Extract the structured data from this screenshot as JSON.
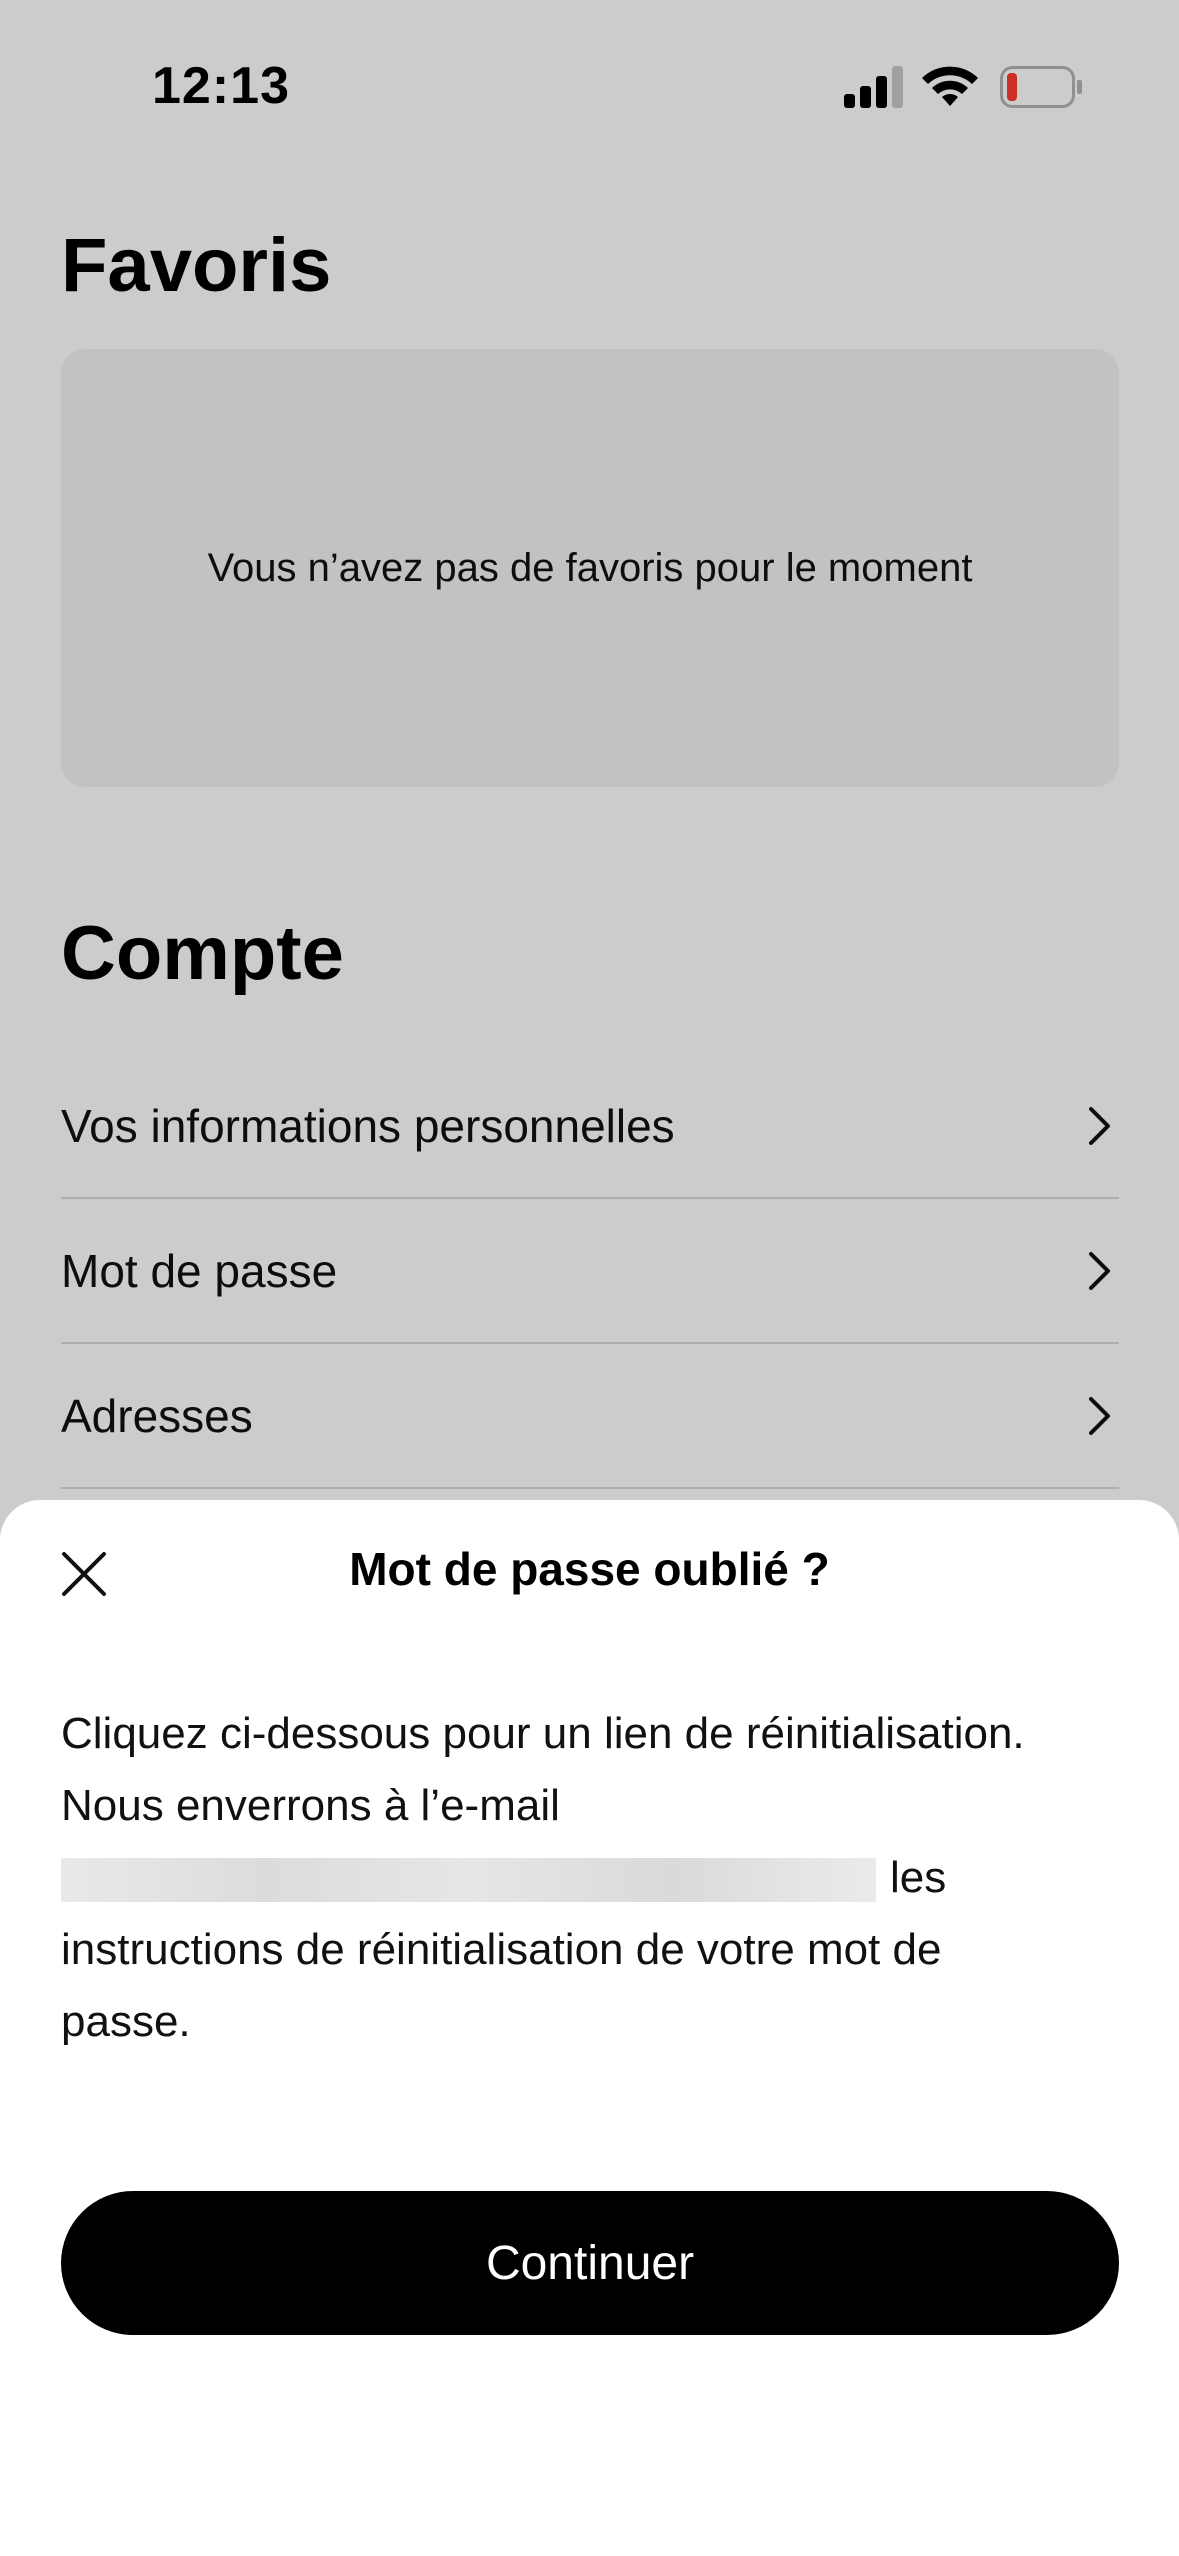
{
  "status_bar": {
    "time": "12:13",
    "signal_icon": "cellular-signal-icon",
    "wifi_icon": "wifi-icon",
    "battery_icon": "battery-low-icon",
    "battery_color": "#ff3b30"
  },
  "favoris": {
    "title": "Favoris",
    "empty_message": "Vous n’avez pas de favoris pour le moment"
  },
  "compte": {
    "title": "Compte",
    "items": [
      {
        "label": "Vos informations personnelles"
      },
      {
        "label": "Mot de passe"
      },
      {
        "label": "Adresses"
      }
    ]
  },
  "sheet": {
    "title": "Mot de passe oublié ?",
    "close_icon": "close-icon",
    "body_line1": "Cliquez ci-dessous pour un lien de réinitialisation.",
    "body_line2": "Nous enverrons à l’e-mail",
    "body_after_email": "les",
    "body_line4": "instructions de réinitialisation de votre mot de",
    "body_line5": "passe.",
    "continue_label": "Continuer"
  },
  "colors": {
    "background": "#ffffff",
    "card": "#f4f3f2",
    "button": "#000000",
    "button_text": "#ffffff"
  }
}
